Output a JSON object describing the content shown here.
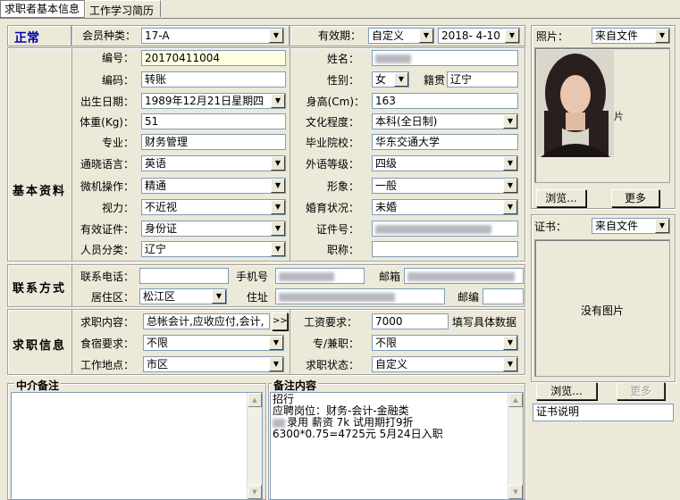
{
  "tabs": [
    "求职者基本信息",
    "工作学习简历"
  ],
  "status": "正常",
  "sections": {
    "basic": "基本资料",
    "contact": "联系方式",
    "job": "求职信息",
    "agent_note": "中介备注",
    "note": "备注内容"
  },
  "header": {
    "member_type_label": "会员种类：",
    "member_type": "17-A",
    "validity_label": "有效期：",
    "validity_mode": "自定义",
    "validity_date": "2018- 4-10"
  },
  "basic": {
    "number_label": "编号：",
    "number": "20170411004",
    "name_label": "姓名：",
    "code_label": "编码：",
    "code": "转账",
    "gender_label": "性别：",
    "gender": "女",
    "native_label": "籍贯",
    "native": "辽宁",
    "birth_label": "出生日期：",
    "birth": "1989年12月21日星期四",
    "height_label": "身高(Cm)：",
    "height": "163",
    "weight_label": "体重(Kg)：",
    "weight": "51",
    "education_label": "文化程度：",
    "education": "本科(全日制)",
    "major_label": "专业：",
    "major": "财务管理",
    "school_label": "毕业院校：",
    "school": "华东交通大学",
    "language_label": "通晓语言：",
    "language": "英语",
    "fl_level_label": "外语等级：",
    "fl_level": "四级",
    "computer_label": "微机操作：",
    "computer": "精通",
    "image_label": "形象：",
    "image": "一般",
    "vision_label": "视力：",
    "vision": "不近视",
    "marital_label": "婚育状况：",
    "marital": "未婚",
    "id_type_label": "有效证件：",
    "id_type": "身份证",
    "id_no_label": "证件号：",
    "category_label": "人员分类：",
    "category": "辽宁",
    "title_label": "职称："
  },
  "contact": {
    "phone_label": "联系电话：",
    "mobile_label": "手机号",
    "email_label": "邮箱",
    "district_label": "居住区：",
    "district": "松江区",
    "address_label": "住址",
    "zip_label": "邮编"
  },
  "job": {
    "content_label": "求职内容：",
    "content": "总帐会计,应收应付,会计,",
    "more_btn": ">>",
    "salary_label": "工资要求：",
    "salary": "7000",
    "salary_hint": "填写具体数据",
    "board_label": "食宿要求：",
    "board": "不限",
    "parttime_label": "专/兼职：",
    "parttime": "不限",
    "location_label": "工作地点：",
    "location": "市区",
    "job_status_label": "求职状态：",
    "job_status": "自定义"
  },
  "photo": {
    "label": "照片：",
    "source": "来自文件",
    "browse": "浏览...",
    "more": "更多"
  },
  "cert": {
    "label": "证书：",
    "source": "来自文件",
    "placeholder": "没有图片",
    "browse": "浏览...",
    "more": "更多",
    "desc": "证书说明"
  },
  "notes": {
    "lines": [
      "招行",
      "应聘岗位：财务-会计-金融类",
      "",
      "录用 薪资 7k 试用期打9折",
      "6300*0.75=4725元 5月24日入职"
    ]
  }
}
